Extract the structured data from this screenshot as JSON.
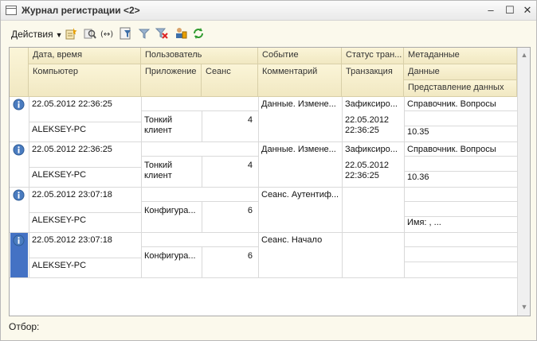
{
  "window": {
    "title": "Журнал регистрации <2>",
    "minimize": "–",
    "maximize": "☐",
    "close": "✕"
  },
  "toolbar": {
    "actions_label": "Действия",
    "icons": [
      "new-icon",
      "find-icon",
      "goto-icon",
      "filter-icon",
      "filter-clear-icon",
      "delete-filter-icon",
      "users-icon",
      "refresh-icon"
    ]
  },
  "columns": {
    "row1": [
      "Дата, время",
      "Пользователь",
      "Событие",
      "Статус тран...",
      "Метаданные"
    ],
    "row2": [
      "Компьютер",
      "Приложение",
      "Сеанс",
      "Комментарий",
      "Транзакция",
      "Данные"
    ],
    "row3": "Представление данных"
  },
  "rows": [
    {
      "datetime": "22.05.2012 22:36:25",
      "computer": "ALEKSEY-PC",
      "application_l1": "Тонкий",
      "application_l2": "клиент",
      "session": "4",
      "event": "Данные. Измене...",
      "status": "Зафиксиро...",
      "transaction_l1": "22.05.2012",
      "transaction_l2": "22:36:25",
      "metadata": "Справочник. Вопросы",
      "data_presentation": "10.35",
      "selected": false
    },
    {
      "datetime": "22.05.2012 22:36:25",
      "computer": "ALEKSEY-PC",
      "application_l1": "Тонкий",
      "application_l2": "клиент",
      "session": "4",
      "event": "Данные. Измене...",
      "status": "Зафиксиро...",
      "transaction_l1": "22.05.2012",
      "transaction_l2": "22:36:25",
      "metadata": "Справочник. Вопросы",
      "data_presentation": "10.36",
      "selected": false
    },
    {
      "datetime": "22.05.2012 23:07:18",
      "computer": "ALEKSEY-PC",
      "application_l1": "Конфигура...",
      "application_l2": "",
      "session": "6",
      "event": "Сеанс. Аутентиф...",
      "status": "",
      "transaction_l1": "",
      "transaction_l2": "",
      "metadata": "",
      "data_presentation": "Имя: , ...",
      "selected": false
    },
    {
      "datetime": "22.05.2012 23:07:18",
      "computer": "ALEKSEY-PC",
      "application_l1": "Конфигура...",
      "application_l2": "",
      "session": "6",
      "event": "Сеанс. Начало",
      "status": "",
      "transaction_l1": "",
      "transaction_l2": "",
      "metadata": "",
      "data_presentation": "",
      "selected": true
    }
  ],
  "footer": {
    "filter_label": "Отбор:"
  },
  "colors": {
    "header_bg": "#f3ebc6",
    "window_bg": "#fbf9ec",
    "selection": "#4472c4",
    "info_icon": "#4a7cc0"
  }
}
